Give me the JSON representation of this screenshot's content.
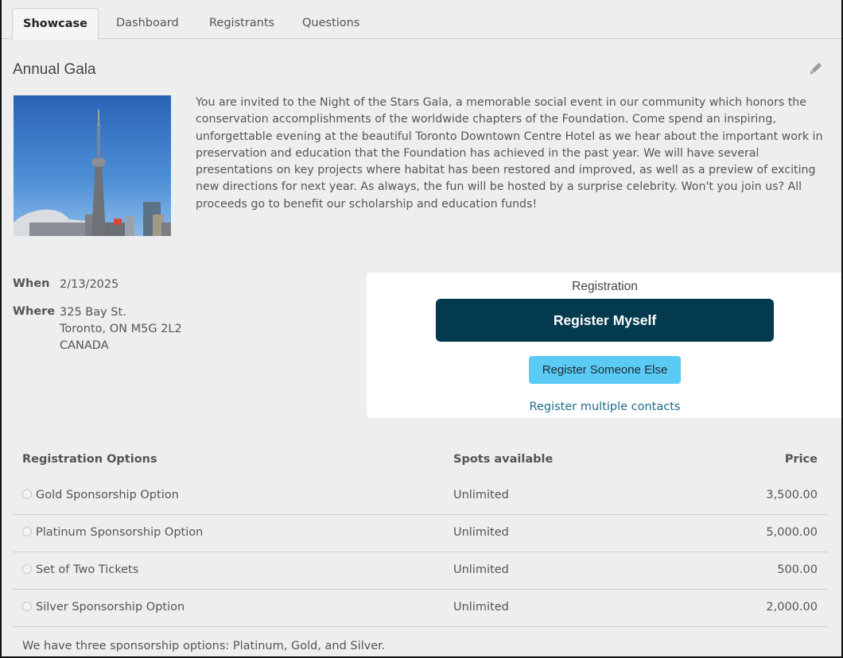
{
  "tabs": [
    {
      "label": "Showcase",
      "active": true
    },
    {
      "label": "Dashboard",
      "active": false
    },
    {
      "label": "Registrants",
      "active": false
    },
    {
      "label": "Questions",
      "active": false
    }
  ],
  "event": {
    "title": "Annual Gala",
    "edit_icon": "pencil-icon",
    "image_alt": "CN Tower Toronto skyline",
    "description": "You are invited to the Night of the Stars Gala, a memorable social event in our community which honors the conservation accomplishments of the worldwide chapters of the Foundation. Come spend an inspiring, unforgettable evening at the beautiful Toronto Downtown Centre Hotel as we hear about the important work in preservation and education that the Foundation has achieved in the past year. We will have several presentations on key projects where habitat has been restored and improved, as well as a preview of exciting new directions for next year. As always, the fun will be hosted by a surprise celebrity. Won't you join us? All proceeds go to benefit our scholarship and education funds!",
    "when_label": "When",
    "when_value": "2/13/2025",
    "where_label": "Where",
    "where_lines": [
      "325 Bay St.",
      "Toronto, ON M5G 2L2",
      "CANADA"
    ]
  },
  "registration": {
    "heading": "Registration",
    "register_myself": "Register Myself",
    "register_someone_else": "Register Someone Else",
    "register_multiple": "Register multiple contacts",
    "colors": {
      "primary": "#033a4d",
      "secondary": "#5bcbf5",
      "link": "#1b6a8a"
    }
  },
  "options_table": {
    "headers": {
      "name": "Registration Options",
      "spots": "Spots available",
      "price": "Price"
    },
    "rows": [
      {
        "name": "Gold Sponsorship Option",
        "spots": "Unlimited",
        "price": "3,500.00"
      },
      {
        "name": "Platinum Sponsorship Option",
        "spots": "Unlimited",
        "price": "5,000.00"
      },
      {
        "name": "Set of Two Tickets",
        "spots": "Unlimited",
        "price": "500.00"
      },
      {
        "name": "Silver Sponsorship Option",
        "spots": "Unlimited",
        "price": "2,000.00"
      }
    ],
    "footnote": "We have three sponsorship options: Platinum, Gold, and Silver."
  }
}
